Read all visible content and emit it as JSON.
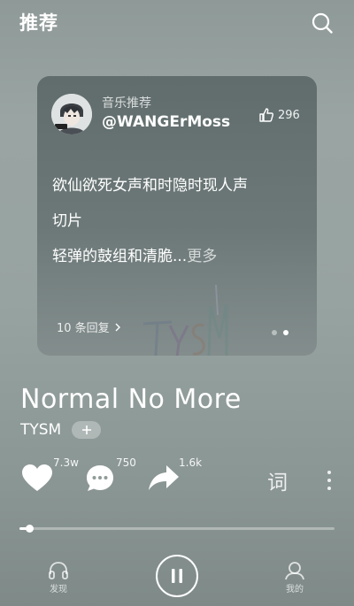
{
  "header": {
    "title": "推荐"
  },
  "card": {
    "label": "音乐推荐",
    "author": "@WANGErMoss",
    "likes": "296",
    "text_lines": [
      "欲仙欲死女声和时隐时现人声",
      "切片",
      "轻弹的鼓组和清脆..."
    ],
    "more_label": "更多",
    "replies_label": "10 条回复",
    "page_count": 2,
    "active_page": 2
  },
  "song": {
    "title": "Normal No More",
    "artist": "TYSM"
  },
  "actions": {
    "like_count": "7.3w",
    "comment_count": "750",
    "share_count": "1.6k",
    "lyrics_label": "词"
  },
  "progress": {
    "fraction": 0.03
  },
  "nav": {
    "discover_label": "发现",
    "mine_label": "我的"
  }
}
